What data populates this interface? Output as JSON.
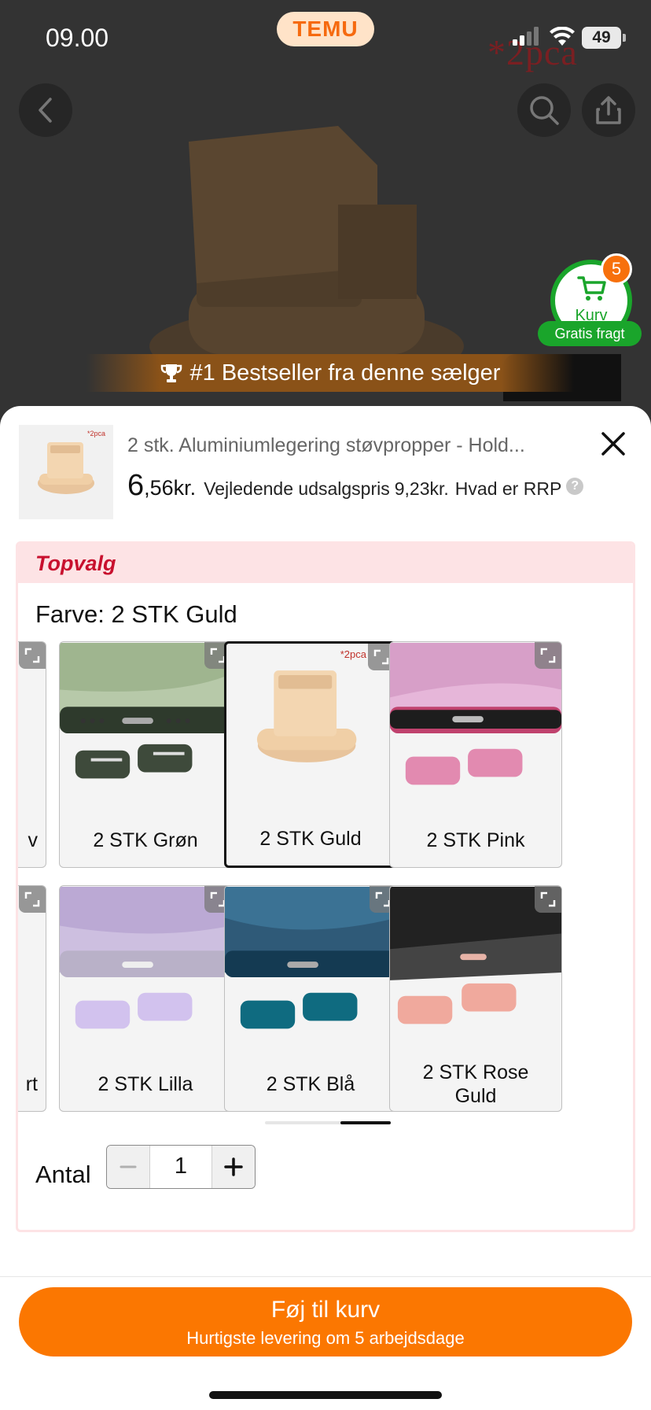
{
  "status_bar": {
    "time": "09.00",
    "battery": "49"
  },
  "app": {
    "logo": "TEMU"
  },
  "background": {
    "image_text": "*2pca",
    "cart": {
      "label": "Kurv",
      "badge": "5",
      "free_shipping": "Gratis fragt"
    },
    "bestseller_banner": "#1 Bestseller fra denne sælger"
  },
  "sheet": {
    "thumb_tag": "*2pca",
    "title": "2 stk. Aluminiumlegering støvpropper - Hold...",
    "price": {
      "integer": "6",
      "rest": ",56kr."
    },
    "rrp": {
      "label": "Vejledende udsalgspris",
      "value": "9,23kr.",
      "help": "Hvad er RRP",
      "help_icon": "?"
    },
    "topvalg": "Topvalg",
    "color": {
      "label": "Farve:",
      "value": "2 STK Guld"
    },
    "variants": [
      {
        "label": "v"
      },
      {
        "label": "2 STK Grøn"
      },
      {
        "label": "2 STK Guld",
        "tag": "*2pca"
      },
      {
        "label": "2 STK Pink"
      },
      {
        "label": "rt"
      },
      {
        "label": "2 STK Lilla"
      },
      {
        "label": "2 STK Blå"
      },
      {
        "label": "2 STK Rose Guld"
      }
    ],
    "quantity": {
      "label": "Antal",
      "value": "1"
    },
    "cta": {
      "title": "Føj til kurv",
      "subtitle": "Hurtigste levering om 5 arbejdsdage"
    }
  },
  "colors": {
    "accent": "#fb7701",
    "green": "#1aa52b",
    "topvalg_red": "#c8102e"
  }
}
